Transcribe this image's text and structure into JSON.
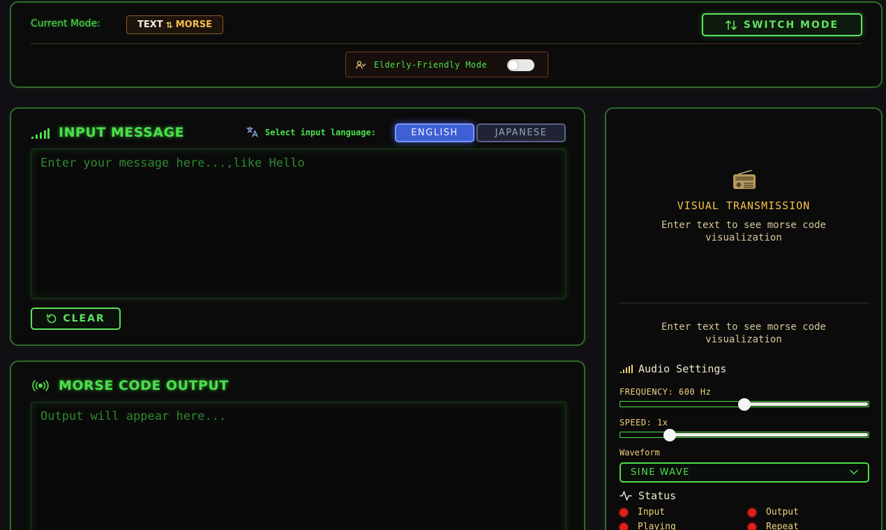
{
  "header": {
    "mode_label": "Current Mode:",
    "mode_text": "TEXT",
    "mode_arrow": "⇅",
    "mode_morse": "MORSE",
    "switch_label": "SWITCH MODE",
    "elderly_label": "Elderly-Friendly Mode",
    "elderly_enabled": false
  },
  "input": {
    "title": "INPUT MESSAGE",
    "lang_label": "Select input language:",
    "languages": [
      "ENGLISH",
      "JAPANESE"
    ],
    "selected_language": "ENGLISH",
    "placeholder": "Enter your message here...,like Hello",
    "clear_label": "CLEAR"
  },
  "output": {
    "title": "MORSE CODE OUTPUT",
    "placeholder": "Output will appear here..."
  },
  "visual": {
    "title": "VISUAL TRANSMISSION",
    "subtitle": "Enter text to see morse code visualization",
    "subtitle2": "Enter text to see morse code visualization"
  },
  "audio": {
    "title": "Audio Settings",
    "frequency_label": "FREQUENCY: 600 Hz",
    "frequency_fraction": 0.5,
    "speed_label": "SPEED: 1x",
    "speed_fraction": 0.2,
    "waveform_label": "Waveform",
    "waveform_value": "SINE WAVE"
  },
  "status": {
    "title": "Status",
    "items": [
      "Input",
      "Output",
      "Playing",
      "Repeat"
    ],
    "color": "#e0201a"
  },
  "colors": {
    "accent": "#4be04b",
    "gold": "#f5c04a",
    "language_active": "#3e5fd6"
  }
}
